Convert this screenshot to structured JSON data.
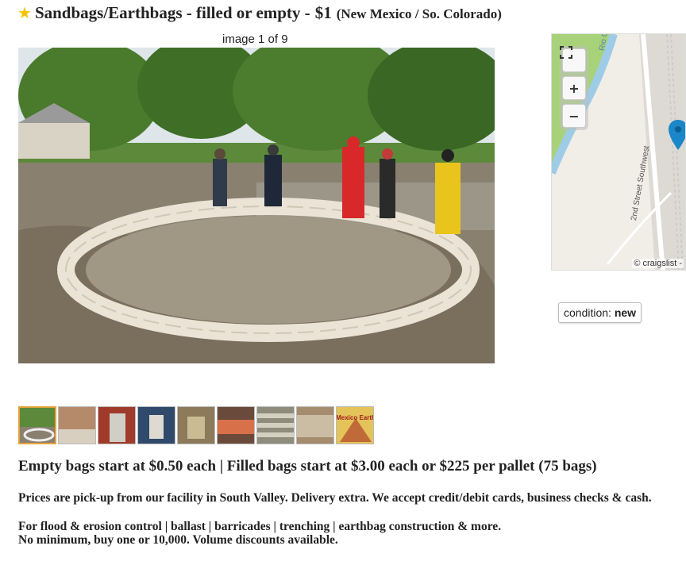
{
  "posting": {
    "star": "★",
    "title": "Sandbags/Earthbags - filled or empty -",
    "price": "$1",
    "location": "(New Mexico / So. Colorado)"
  },
  "gallery": {
    "counter": "image 1 of 9",
    "thumbnail_count": 9,
    "active_index": 0,
    "thumb_last_text": "New Mexico Earthbags"
  },
  "map": {
    "attribution": "© craigslist -",
    "street_label": "2nd Street Southwest",
    "river_label": "Rio G",
    "fullscreen_icon": "fullscreen-icon",
    "zoom_in_label": "+",
    "zoom_out_label": "−",
    "pin_icon": "map-pin-icon",
    "pin_color": "#1a87c9"
  },
  "attributes": {
    "condition_label": "condition:",
    "condition_value": "new"
  },
  "body": {
    "headline": "Empty bags start at $0.50 each | Filled bags start at $3.00 each or $225 per pallet (75 bags)",
    "line1": "Prices are pick-up from our facility in South Valley. Delivery extra. We accept credit/debit cards, business checks & cash.",
    "line2": "For flood & erosion control | ballast | barricades | trenching | earthbag construction & more.",
    "line3": "No minimum, buy one or 10,000. Volume discounts available."
  }
}
